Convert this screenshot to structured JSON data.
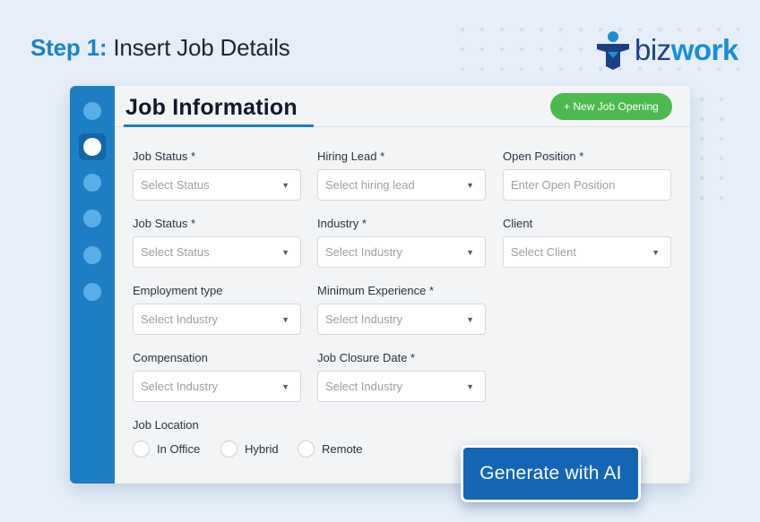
{
  "header": {
    "step_number": "Step 1:",
    "step_title": "Insert Job Details"
  },
  "logo": {
    "icon": "bizwork-person-icon",
    "part1": "biz",
    "part2": "work",
    "colors": {
      "dark": "#1e3f86",
      "light": "#1a8fd6"
    }
  },
  "form": {
    "title": "Job Information",
    "new_job_button": "+ New Job Opening",
    "rows": [
      [
        {
          "label": "Job Status *",
          "placeholder": "Select Status",
          "dropdown": true
        },
        {
          "label": "Hiring Lead *",
          "placeholder": "Select hiring lead",
          "dropdown": true
        },
        {
          "label": "Open Position *",
          "placeholder": "Enter Open Position",
          "dropdown": false
        }
      ],
      [
        {
          "label": "Job Status *",
          "placeholder": "Select Status",
          "dropdown": true
        },
        {
          "label": "Industry *",
          "placeholder": "Select Industry",
          "dropdown": true
        },
        {
          "label": "Client",
          "placeholder": "Select Client",
          "dropdown": true
        }
      ],
      [
        {
          "label": "Employment type",
          "placeholder": "Select Industry",
          "dropdown": true
        },
        {
          "label": "Minimum  Experience *",
          "placeholder": "Select Industry",
          "dropdown": true
        }
      ],
      [
        {
          "label": "Compensation",
          "placeholder": "Select Industry",
          "dropdown": true
        },
        {
          "label": "Job Closure Date *",
          "placeholder": "Select Industry",
          "dropdown": true
        }
      ]
    ],
    "caret": "▼",
    "location": {
      "label": "Job Location",
      "options": [
        "In Office",
        "Hybrid",
        "Remote"
      ]
    }
  },
  "ai_button": "Generate with AI",
  "colors": {
    "accent_blue": "#1c7fc3",
    "green": "#4cba4f",
    "ai_button": "#1565b6"
  }
}
